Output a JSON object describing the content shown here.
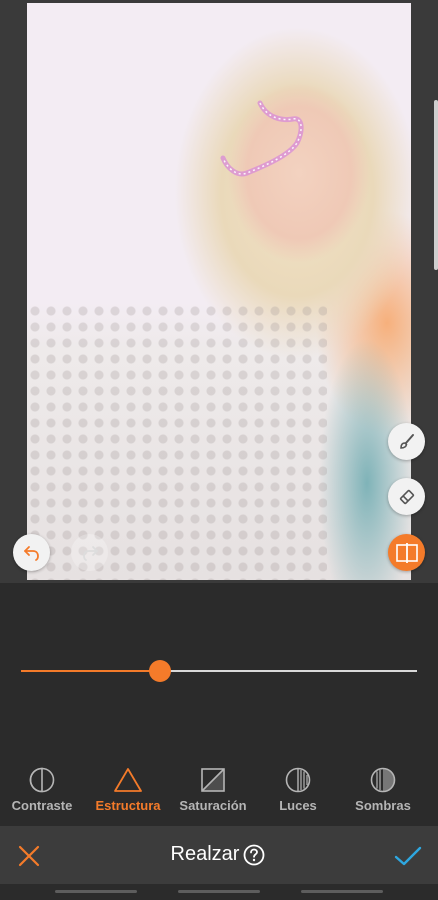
{
  "screen_title": "Realzar",
  "slider": {
    "value_fraction": 0.35
  },
  "tools": [
    {
      "label": "Contraste",
      "icon": "contrast-icon",
      "active": false
    },
    {
      "label": "Estructura",
      "icon": "triangle-icon",
      "active": true
    },
    {
      "label": "Saturación",
      "icon": "saturation-icon",
      "active": false
    },
    {
      "label": "Luces",
      "icon": "highlights-icon",
      "active": false
    },
    {
      "label": "Sombras",
      "icon": "shadows-icon",
      "active": false
    }
  ],
  "colors": {
    "accent": "#f47b2a",
    "background": "#2b2b2b",
    "bar": "#3c3c3c",
    "check": "#2ea7e0"
  }
}
